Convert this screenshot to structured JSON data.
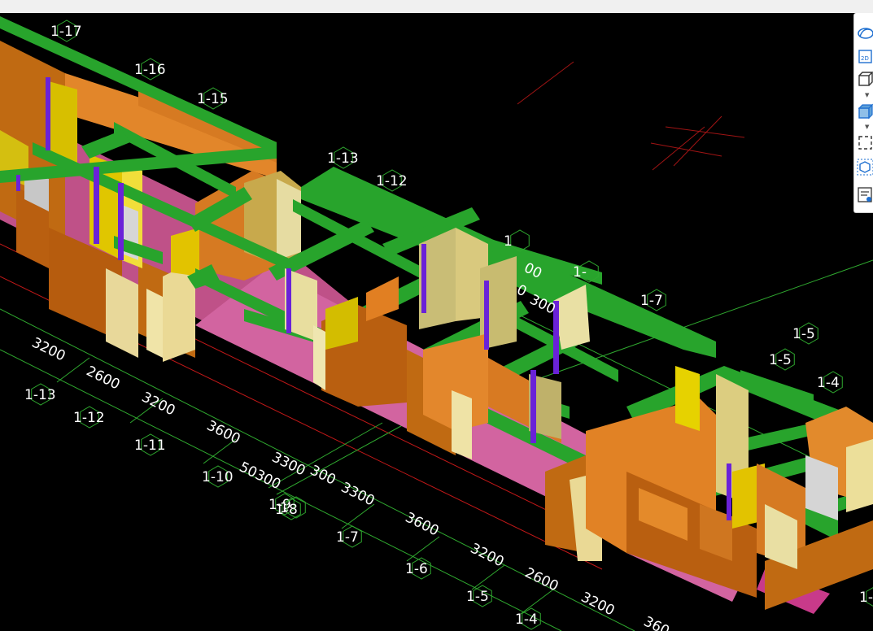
{
  "toolbar": {
    "items": [
      {
        "icon": "orbit-icon"
      },
      {
        "icon": "2d-view-icon",
        "text": "2D"
      },
      {
        "icon": "3d-box-outline-icon"
      },
      {
        "icon": "3d-box-solid-icon"
      },
      {
        "icon": "select-region-icon"
      },
      {
        "icon": "component-view-icon"
      },
      {
        "icon": "properties-list-icon"
      }
    ]
  },
  "axis_labels": {
    "a1": "1-17",
    "a2": "1-16",
    "a3": "1-15",
    "a4": "1-13",
    "a5": "1-12",
    "a6": "1-7",
    "a7": "1-5",
    "a8": "1-5",
    "a9": "1-4",
    "b1": "1-13",
    "b2": "1-12",
    "b3": "1-11",
    "b4": "1-10",
    "b5": "1-9",
    "b6": "1-8",
    "b7": "1-7",
    "b8": "1-6",
    "b9": "1-5",
    "b10": "1-4",
    "frag1": "1",
    "frag2": "1-",
    "frag3": "1-",
    "frag4": "1"
  },
  "dimensions": {
    "d1": "3200",
    "d2": "2600",
    "d3": "3200",
    "d4": "3600",
    "d5": "3300",
    "d6": "300",
    "d7": "3300",
    "d8": "50300",
    "d9": "3600",
    "d10": "3200",
    "d11": "2600",
    "d12": "3200",
    "d13": "360",
    "u1": "00",
    "u2": "0",
    "u3": "300"
  }
}
